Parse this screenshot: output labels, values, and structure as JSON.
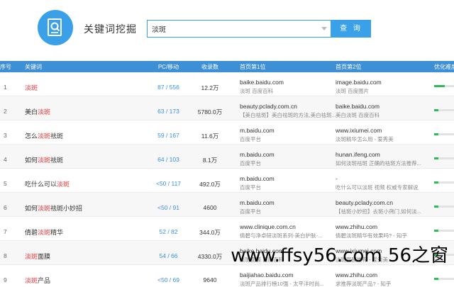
{
  "app": {
    "title": "关键词挖掘"
  },
  "search": {
    "value": "淡斑",
    "button_label": "查 询"
  },
  "table": {
    "headers": [
      "序号",
      "关键词",
      "PC/移动",
      "收录数",
      "首页第1位",
      "首页第2位",
      "优化难度"
    ],
    "rows": [
      {
        "idx": "1",
        "kw_pre": "",
        "kw_hl": "淡斑",
        "kw_post": "",
        "pc": "87 / 556",
        "vol": "12.2万",
        "u1": "baike.baidu.com",
        "d1": "淡斑  百度百科",
        "u2": "image.baidu.com",
        "d2": "淡斑  百度图片",
        "difficulty": 0.5
      },
      {
        "idx": "2",
        "kw_pre": "美白",
        "kw_hl": "淡斑",
        "kw_post": "",
        "pc": "63 / 173",
        "vol": "5780.0万",
        "u1": "beauty.pclady.com.cn",
        "d1": "【美白祛斑】美白祛斑的方法,美白祛斑...",
        "u2": "baike.baidu.com",
        "d2": "美白淡斑  百度百科",
        "difficulty": 0.2
      },
      {
        "idx": "3",
        "kw_pre": "怎么",
        "kw_hl": "淡斑",
        "kw_post": "祛斑",
        "pc": "59 / 167",
        "vol": "11.6万",
        "u1": "m.baidu.com",
        "d1": "百度平台",
        "u2": "www.ixiumei.com",
        "d2": "淡斑精华怎么用 - 爱秀美",
        "difficulty": 0.2
      },
      {
        "idx": "4",
        "kw_pre": "如何",
        "kw_hl": "淡斑",
        "kw_post": "祛斑",
        "pc": "64 / 103",
        "vol": "8.1万",
        "u1": "m.baidu.com",
        "d1": "百度平台",
        "u2": "hunan.ifeng.com",
        "d2": "如何淡斑祛斑 正确的祛斑方法推荐...",
        "difficulty": 0.2
      },
      {
        "idx": "5",
        "kw_pre": "吃什么可以",
        "kw_hl": "淡斑",
        "kw_post": "",
        "pc": "<50 / 117",
        "vol": "492.0万",
        "u1": "m.baidu.com",
        "d1": "百度平台",
        "u2": "-",
        "d2": "吃什么可以淡斑  视频  权威专家解说",
        "difficulty": 0.2
      },
      {
        "idx": "6",
        "kw_pre": "如何",
        "kw_hl": "淡斑",
        "kw_post": "祛斑小妙招",
        "pc": "<50 / 91",
        "vol": "4600",
        "u1": "m.baidu.com",
        "d1": "百度平台",
        "u2": "beauty.pclady.com.cn",
        "d2": "【祛斑小妙招】去斑小窍门,如何淡...",
        "difficulty": 0.2
      },
      {
        "idx": "7",
        "kw_pre": "倩碧",
        "kw_hl": "淡斑",
        "kw_post": "精华",
        "pc": "52 / 82",
        "vol": "344.0万",
        "u1": "www.clinique.com.cn",
        "d1": "倩碧与净卓研淡斑系列-美白护肤-...",
        "u2": "www.zhihu.com",
        "d2": "倩碧淡斑精华有效果吗? - 知乎",
        "difficulty": 0.2
      },
      {
        "idx": "8",
        "kw_pre": "",
        "kw_hl": "淡斑",
        "kw_post": "面膜",
        "pc": "54 / 66",
        "vol": "4330.0万",
        "u1": "baike.baidu.com",
        "d1": "淡斑面膜  百度百科",
        "u2": "www.ixiumei.com",
        "d2": "淡斑面膜推荐 - 爱秀美",
        "difficulty": 0.2
      },
      {
        "idx": "9",
        "kw_pre": "",
        "kw_hl": "淡斑",
        "kw_post": "产品",
        "pc": "<50 / 69",
        "vol": "9640",
        "u1": "baijiahao.baidu.com",
        "d1": "淡斑产品排行榜10强 - 太平洋时尚...",
        "u2": "www.zhihu.com",
        "d2": "求推荐淡斑产品? - 知乎",
        "difficulty": 0.2
      }
    ]
  },
  "watermark": "www.ffsy56.com 56之窗",
  "colors": {
    "accent": "#3aa0e8",
    "header_bg": "#3d8fd6",
    "highlight": "#e4393c",
    "bar_fill": "#2dbb56"
  },
  "icons": {
    "logo": "search-document-icon",
    "dropdown": "chevron-down-icon"
  }
}
